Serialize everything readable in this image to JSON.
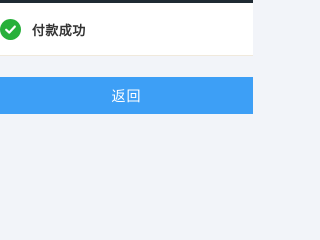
{
  "status": {
    "icon": "check-circle-icon",
    "text": "付款成功",
    "color": "#27b03a"
  },
  "actions": {
    "back_label": "返回",
    "color": "#3d9ff6"
  }
}
